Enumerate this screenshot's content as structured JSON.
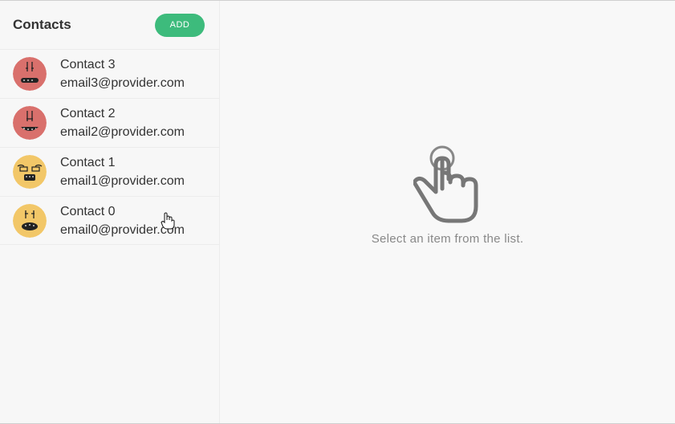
{
  "sidebar": {
    "title": "Contacts",
    "add_label": "ADD",
    "contacts": [
      {
        "name": "Contact 3",
        "email": "email3@provider.com",
        "avatar_color": "#d9706c"
      },
      {
        "name": "Contact 2",
        "email": "email2@provider.com",
        "avatar_color": "#d9706c"
      },
      {
        "name": "Contact 1",
        "email": "email1@provider.com",
        "avatar_color": "#f2c768"
      },
      {
        "name": "Contact 0",
        "email": "email0@provider.com",
        "avatar_color": "#f2c768"
      }
    ]
  },
  "main": {
    "empty_message": "Select an item from the list.",
    "icon": "pointing-hand-icon"
  },
  "colors": {
    "accent": "#3dbb7c"
  }
}
